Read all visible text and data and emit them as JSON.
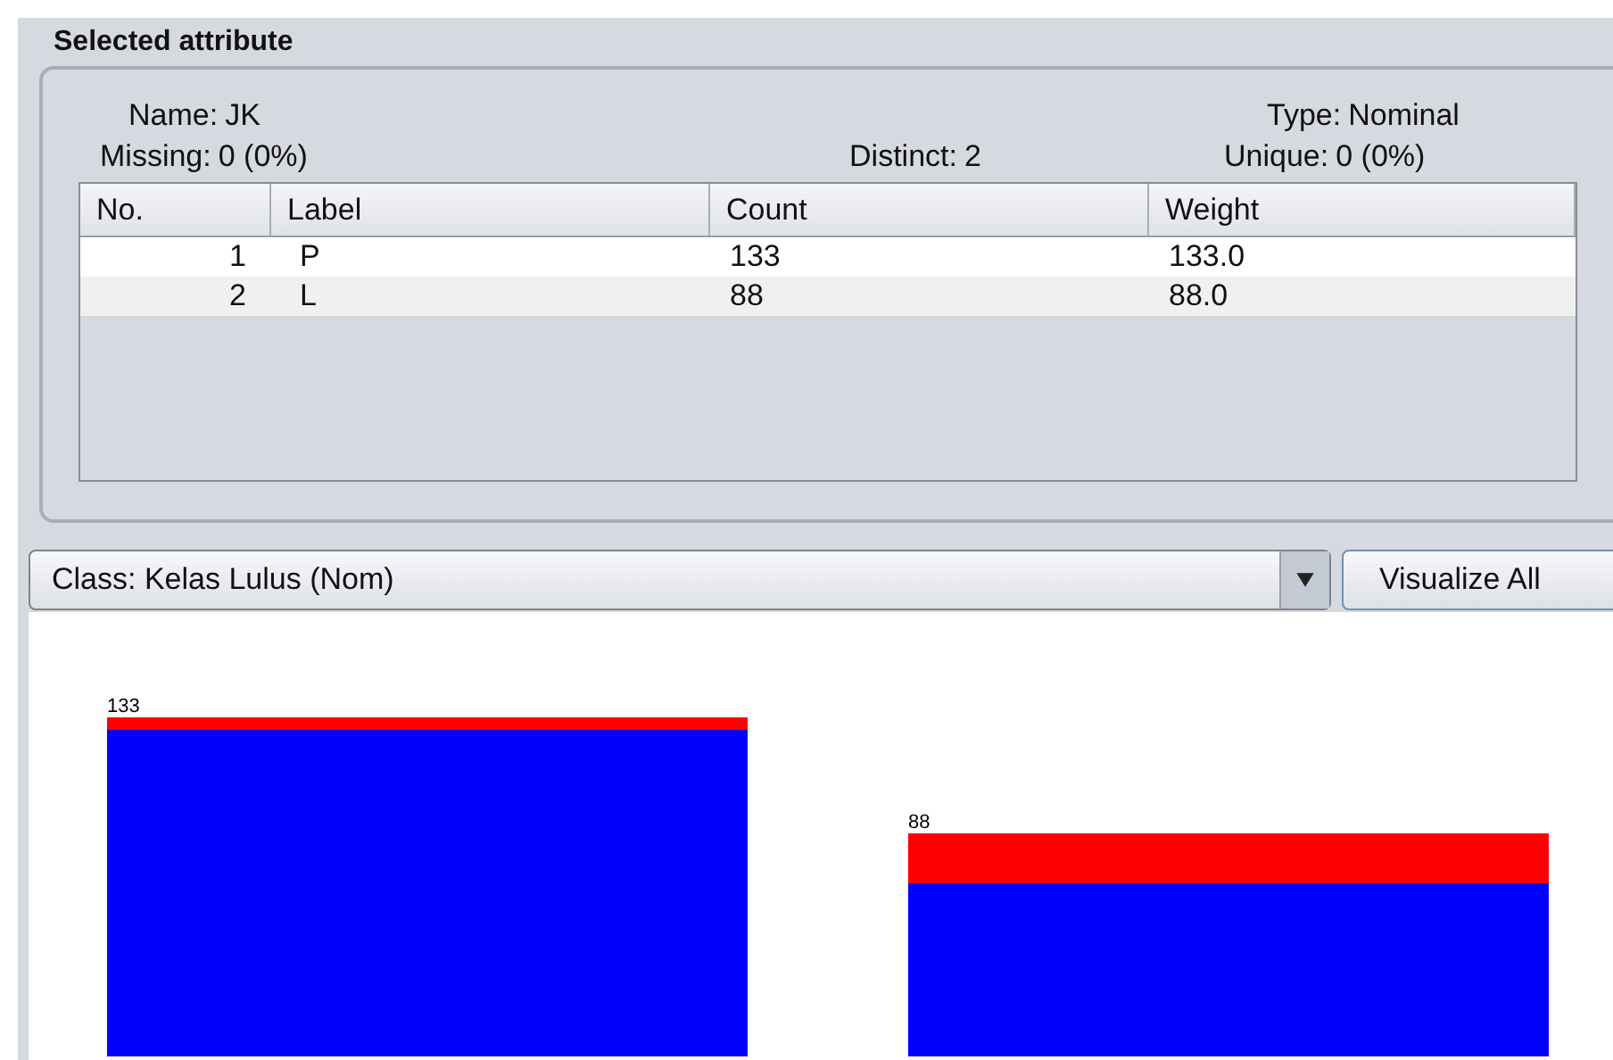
{
  "panel": {
    "title": "Selected attribute"
  },
  "summary": {
    "name": {
      "label": "Name:",
      "value": "JK"
    },
    "type": {
      "label": "Type:",
      "value": "Nominal"
    },
    "missing": {
      "label": "Missing:",
      "value": "0 (0%)"
    },
    "distinct": {
      "label": "Distinct:",
      "value": "2"
    },
    "unique": {
      "label": "Unique:",
      "value": "0 (0%)"
    }
  },
  "table": {
    "columns": [
      "No.",
      "Label",
      "Count",
      "Weight"
    ],
    "rows": [
      {
        "cells": [
          "1",
          "P",
          "133",
          "133.0"
        ]
      },
      {
        "cells": [
          "2",
          "L",
          "88",
          "88.0"
        ]
      }
    ]
  },
  "class_selector": {
    "value": "Class: Kelas Lulus (Nom)"
  },
  "visualize_button": {
    "label": "Visualize All"
  },
  "histogram": {
    "bar_labels": [
      "133",
      "88"
    ]
  }
}
